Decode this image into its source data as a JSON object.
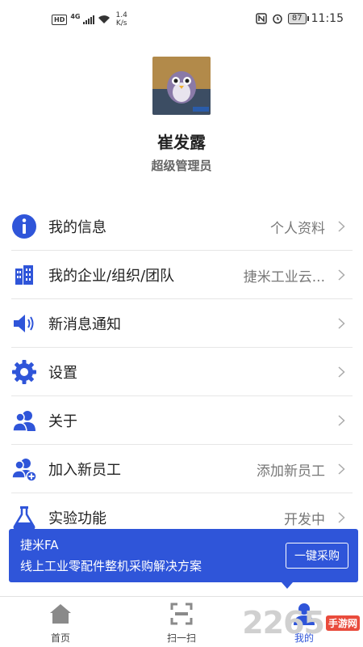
{
  "status_bar": {
    "hd": "HD",
    "network_type": "4G",
    "speed_value": "1.4",
    "speed_unit": "K/s",
    "battery": "87",
    "time": "11:15"
  },
  "profile": {
    "name": "崔发露",
    "role": "超级管理员"
  },
  "menu": [
    {
      "label": "我的信息",
      "value": "个人资料",
      "icon": "info-icon"
    },
    {
      "label": "我的企业/组织/团队",
      "value": "捷米工业云...",
      "icon": "building-icon"
    },
    {
      "label": "新消息通知",
      "value": "",
      "icon": "speaker-icon"
    },
    {
      "label": "设置",
      "value": "",
      "icon": "gear-icon"
    },
    {
      "label": "关于",
      "value": "",
      "icon": "users-icon"
    },
    {
      "label": "加入新员工",
      "value": "添加新员工",
      "icon": "add-user-icon"
    },
    {
      "label": "实验功能",
      "value": "开发中",
      "icon": "flask-icon"
    }
  ],
  "banner": {
    "title": "捷米FA",
    "description": "线上工业零配件整机采购解决方案",
    "button": "一键采购"
  },
  "nav": {
    "home": "首页",
    "scan": "扫一扫",
    "mine": "我的"
  },
  "watermark": {
    "number": "2265",
    "text": "手游网"
  },
  "colors": {
    "accent": "#2f55d9",
    "watermark_red": "#e94b3c"
  }
}
